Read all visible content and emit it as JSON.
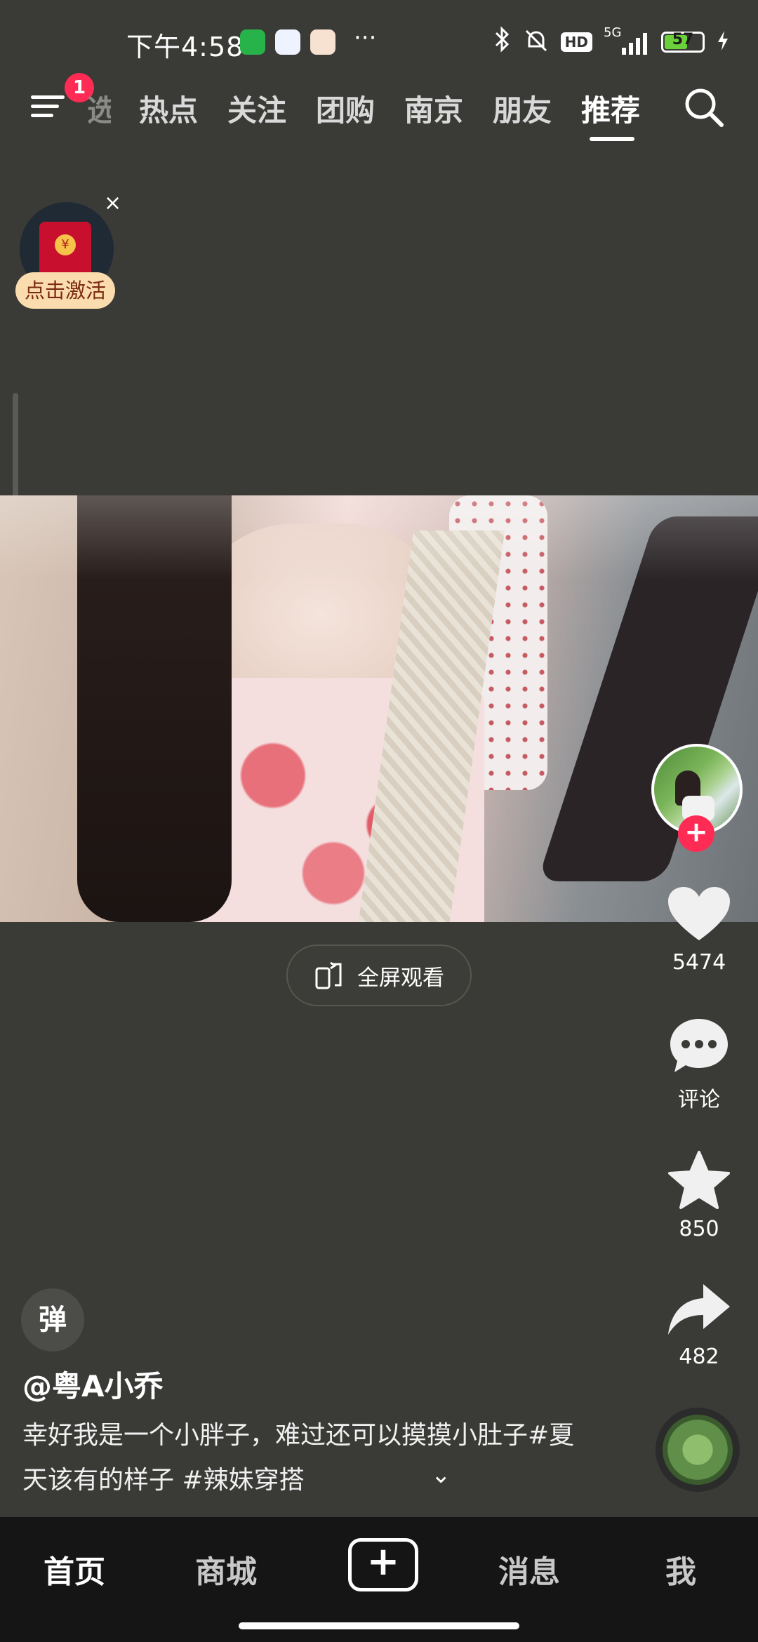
{
  "status_bar": {
    "time": "下午4:58",
    "more": "···",
    "network": "5G",
    "hd": "HD",
    "battery_level": "57",
    "battery_percent": 57,
    "icons": [
      "bluetooth-icon",
      "bell-muted-icon",
      "hd-icon",
      "signal-icon",
      "battery-icon",
      "charging-icon"
    ],
    "app_icons": [
      "wechat-mini-icon",
      "baidu-netdisk-icon",
      "58-app-icon"
    ]
  },
  "top_nav": {
    "badge": "1",
    "partial_tab": "选",
    "tabs": [
      "热点",
      "关注",
      "团购",
      "南京",
      "朋友",
      "推荐"
    ],
    "active_tab": "推荐"
  },
  "red_packet": {
    "label": "点击激活",
    "close": "×",
    "coin": "¥"
  },
  "player": {
    "fullscreen_label": "全屏观看"
  },
  "rail": {
    "follow": "+",
    "likes": "5474",
    "comments_label": "评论",
    "favorites": "850",
    "shares": "482"
  },
  "post": {
    "danmaku": "弹",
    "author": "@粤A小乔",
    "caption": "幸好我是一个小胖子，难过还可以摸摸小肚子#夏天该有的样子 #辣妹穿搭",
    "expand": "⌄"
  },
  "bottom_nav": {
    "items": [
      "首页",
      "商城",
      "+",
      "消息",
      "我"
    ],
    "active": "首页"
  },
  "colors": {
    "background": "#3a3a37",
    "accent": "#fe2c55",
    "bottom_bar": "#151515"
  }
}
